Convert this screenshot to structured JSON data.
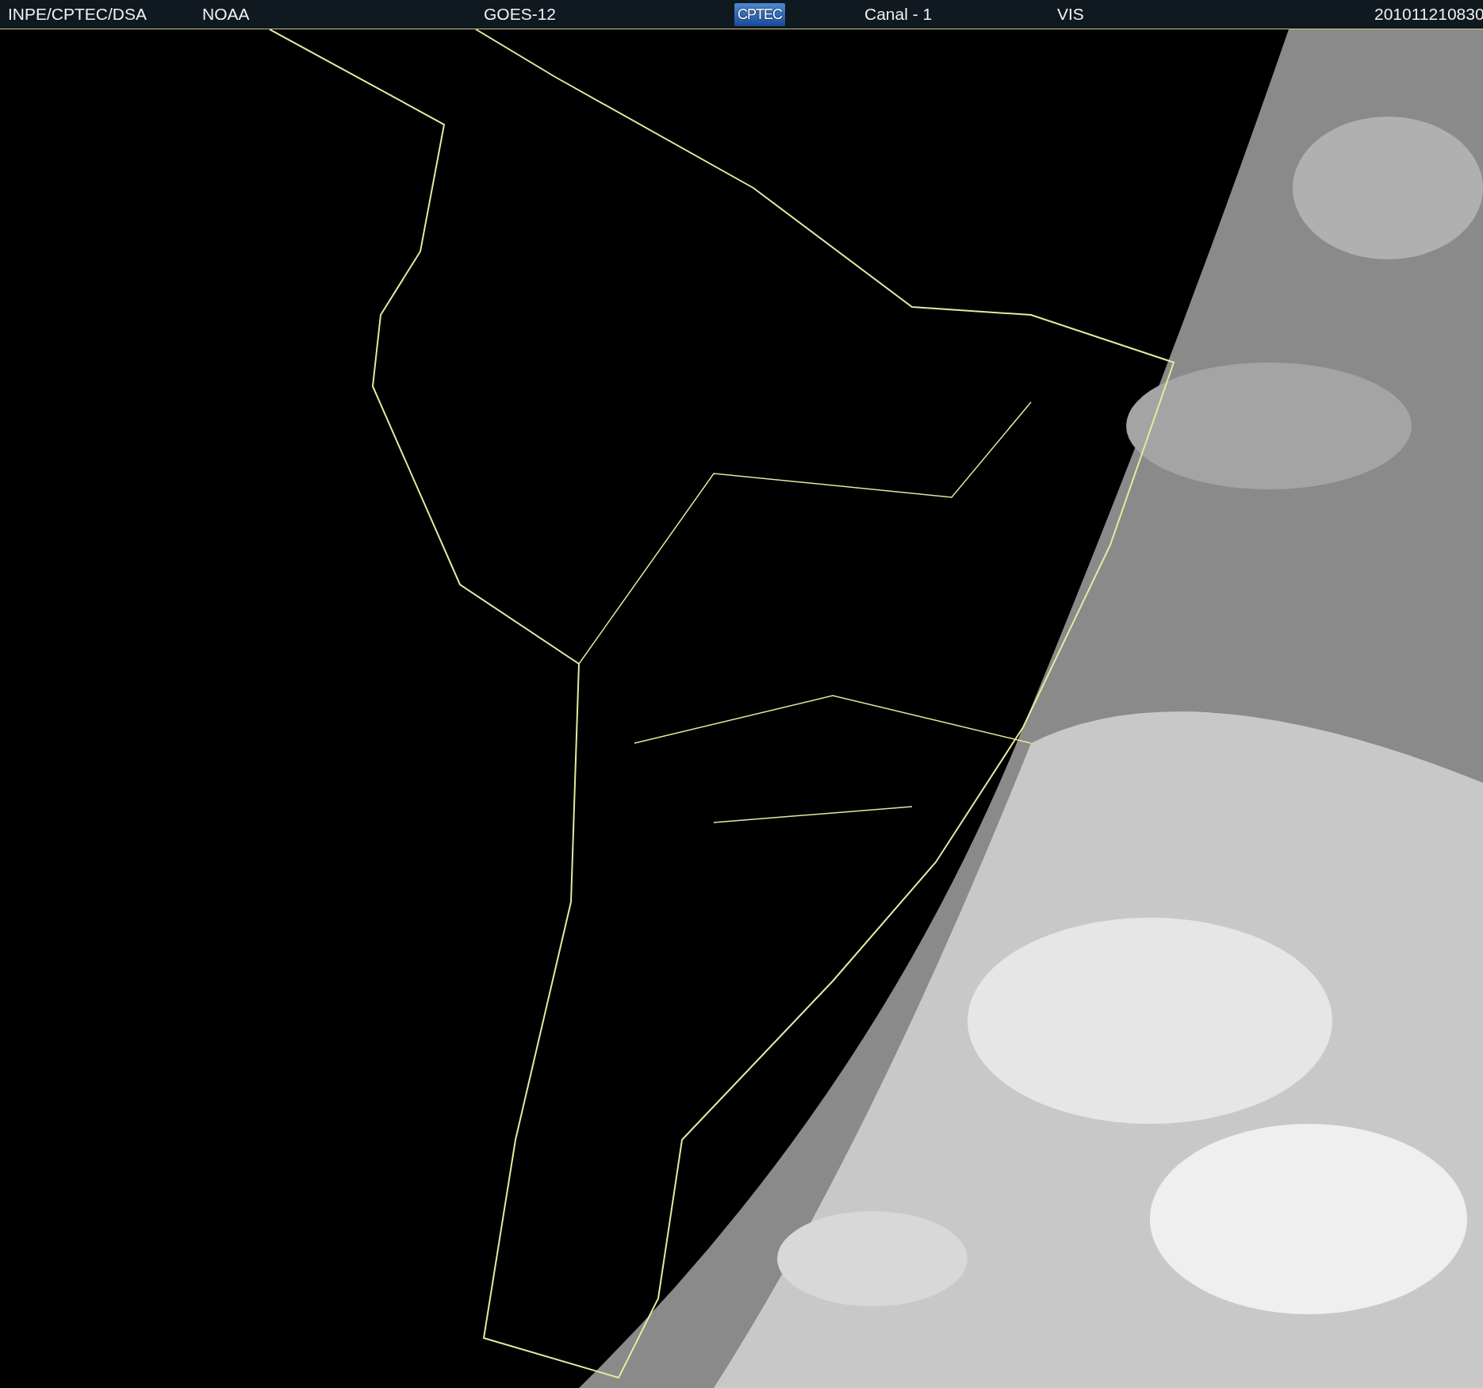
{
  "header": {
    "items": [
      {
        "text": "INPE/CPTEC/DSA",
        "kind": "text"
      },
      {
        "text": "NOAA",
        "kind": "text"
      },
      {
        "text": "GOES-12",
        "kind": "text"
      },
      {
        "text": "CPTEC",
        "kind": "logo"
      },
      {
        "text": "Canal - 1",
        "kind": "text"
      },
      {
        "text": "VIS",
        "kind": "text"
      },
      {
        "text": "201011210830",
        "kind": "text"
      }
    ]
  }
}
